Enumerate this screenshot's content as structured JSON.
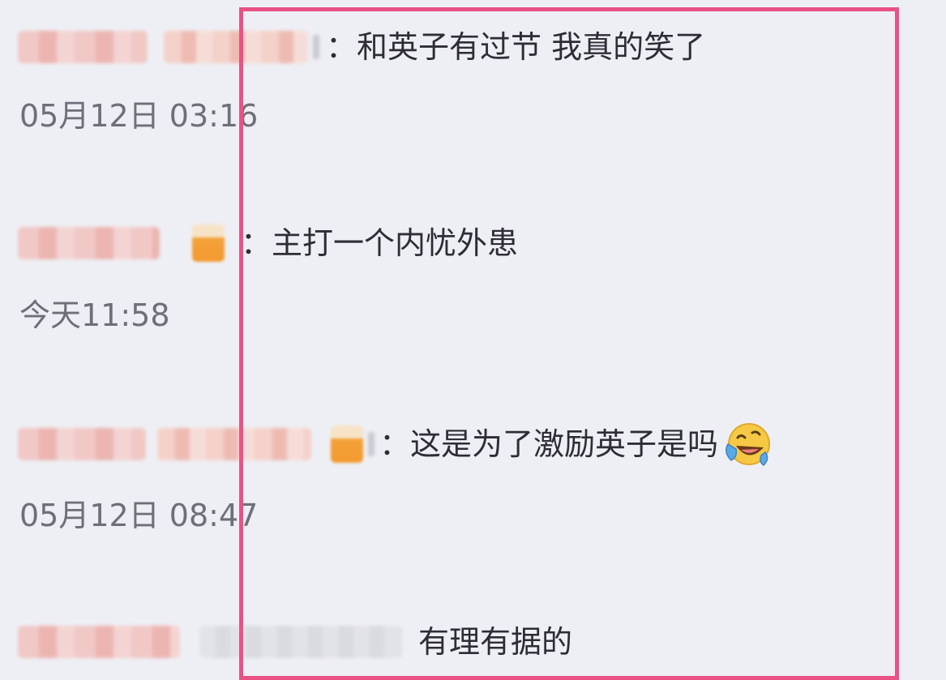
{
  "comments": [
    {
      "text": "：和英子有过节 我真的笑了",
      "time": "05月12日 03:16"
    },
    {
      "text": "：主打一个内忧外患",
      "time": "今天11:58"
    },
    {
      "text": "：这是为了激励英子是吗",
      "time": "05月12日 08:47",
      "emoji": "laughing-crying-emoji"
    },
    {
      "text": "有理有据的",
      "time": ""
    }
  ],
  "colors": {
    "highlight_border": "#ea5285",
    "background": "#eeeff4"
  }
}
